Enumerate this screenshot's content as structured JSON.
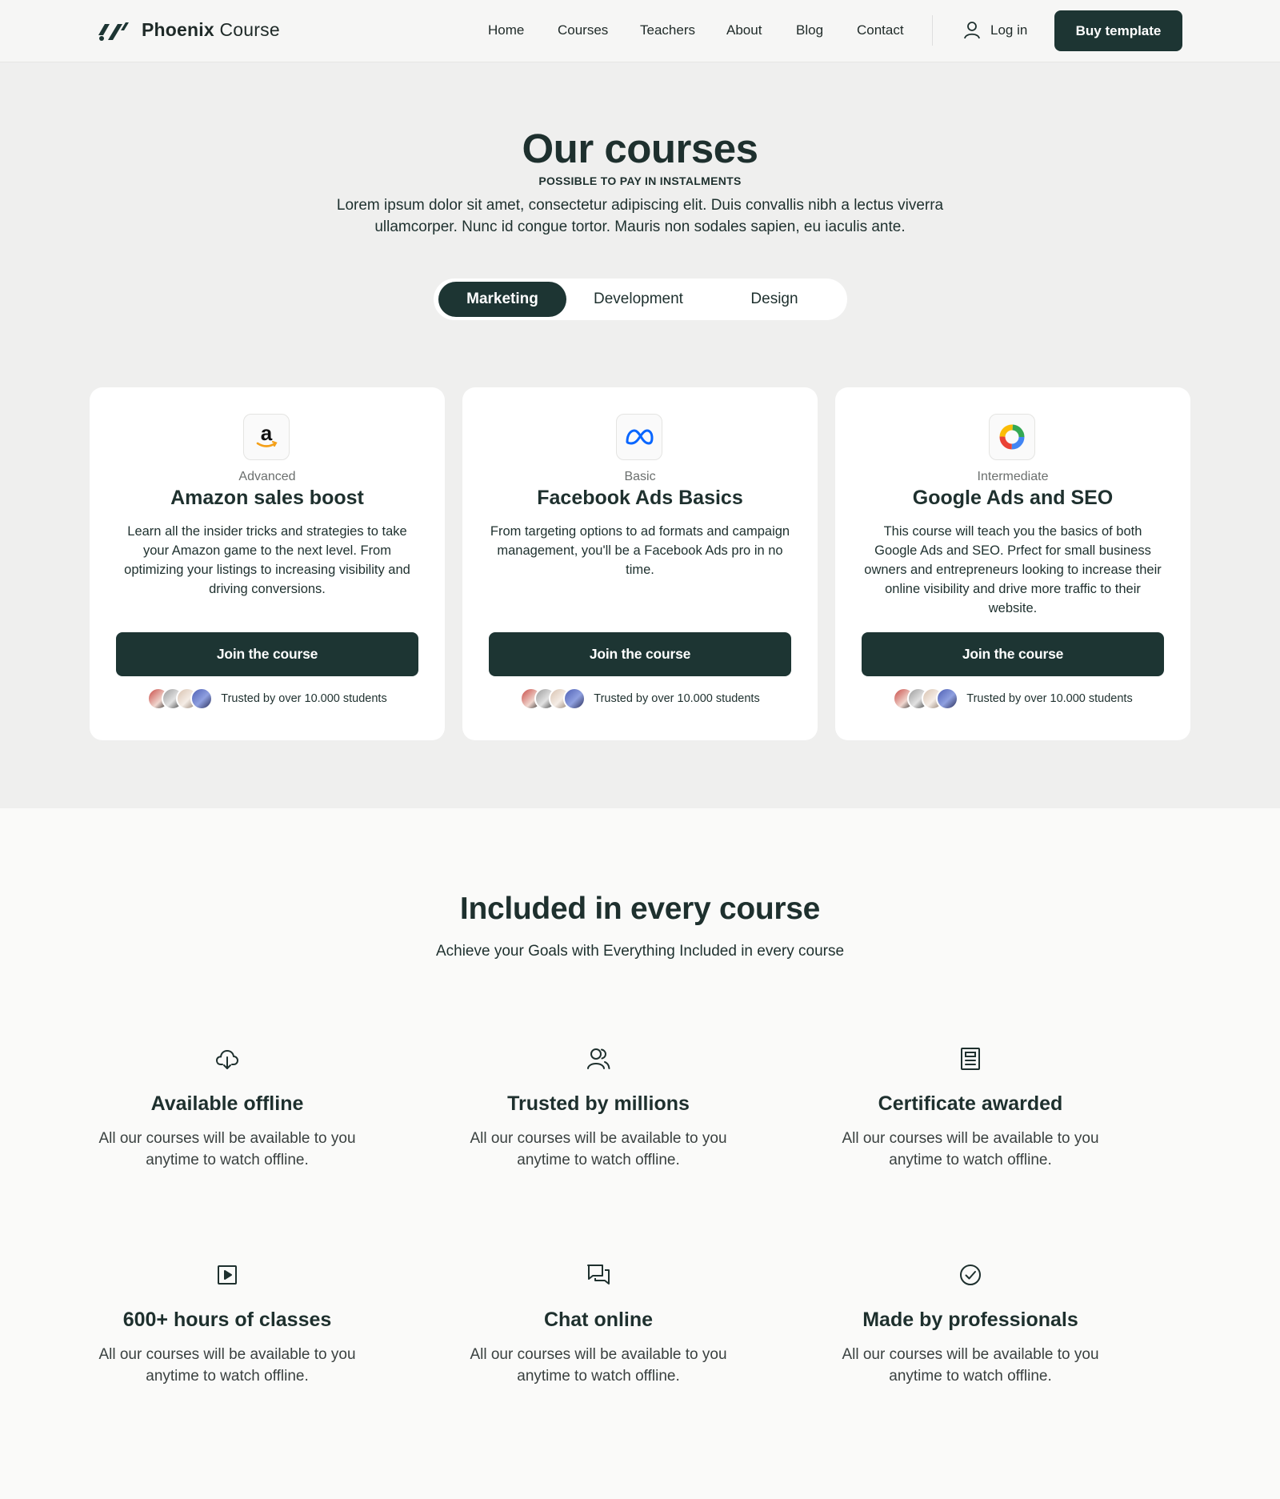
{
  "header": {
    "brand_bold": "Phoenix",
    "brand_light": "Course",
    "nav": [
      "Home",
      "Courses",
      "Teachers",
      "About",
      "Blog",
      "Contact"
    ],
    "login": "Log in",
    "buy": "Buy template"
  },
  "courses": {
    "title": "Our courses",
    "eyebrow": "POSSIBLE TO PAY IN INSTALMENTS",
    "intro": "Lorem ipsum dolor sit amet, consectetur adipiscing elit. Duis convallis nibh a lectus viverra ullamcorper. Nunc id congue tortor. Mauris non sodales sapien, eu iaculis ante.",
    "tabs": [
      "Marketing",
      "Development",
      "Design"
    ],
    "active_tab": "Marketing",
    "cards": [
      {
        "icon": "amazon-logo-icon",
        "level": "Advanced",
        "title": "Amazon sales boost",
        "desc": "Learn all the insider tricks and strategies to take your Amazon game to the next level. From optimizing your listings to increasing visibility and driving conversions.",
        "button": "Join the course",
        "trust": "Trusted by over 10.000 students"
      },
      {
        "icon": "meta-logo-icon",
        "level": "Basic",
        "title": "Facebook Ads Basics",
        "desc": "From targeting options to ad formats and campaign management, you'll be a Facebook Ads pro in no time.",
        "button": "Join the course",
        "trust": "Trusted by over 10.000 students"
      },
      {
        "icon": "google-ads-logo-icon",
        "level": "Intermediate",
        "title": "Google Ads and SEO",
        "desc": "This course will teach you the basics of both Google Ads and SEO. Prfect for small business owners and entrepreneurs looking to increase their online visibility and drive more traffic to their website.",
        "button": "Join the course",
        "trust": "Trusted by over 10.000 students"
      }
    ]
  },
  "included": {
    "title": "Included in every course",
    "subtitle": "Achieve your Goals with Everything Included in every course",
    "features": [
      {
        "icon": "cloud-download-icon",
        "title": "Available offline",
        "desc": "All our courses will be available to you anytime to watch offline."
      },
      {
        "icon": "users-icon",
        "title": "Trusted by millions",
        "desc": "All our courses will be available to you anytime to watch offline."
      },
      {
        "icon": "certificate-icon",
        "title": "Certificate awarded",
        "desc": "All our courses will be available to you anytime to watch offline."
      },
      {
        "icon": "play-square-icon",
        "title": "600+ hours of classes",
        "desc": "All our courses will be available to you anytime to watch offline."
      },
      {
        "icon": "chat-icon",
        "title": "Chat online",
        "desc": "All our courses will be available to you anytime to watch offline."
      },
      {
        "icon": "check-circle-icon",
        "title": "Made by professionals",
        "desc": "All our courses will be available to you anytime to watch offline."
      }
    ]
  },
  "colors": {
    "primary": "#1d3533",
    "text": "#1e302e",
    "section_bg": "#efefee",
    "page_bg": "#fafaf9"
  }
}
